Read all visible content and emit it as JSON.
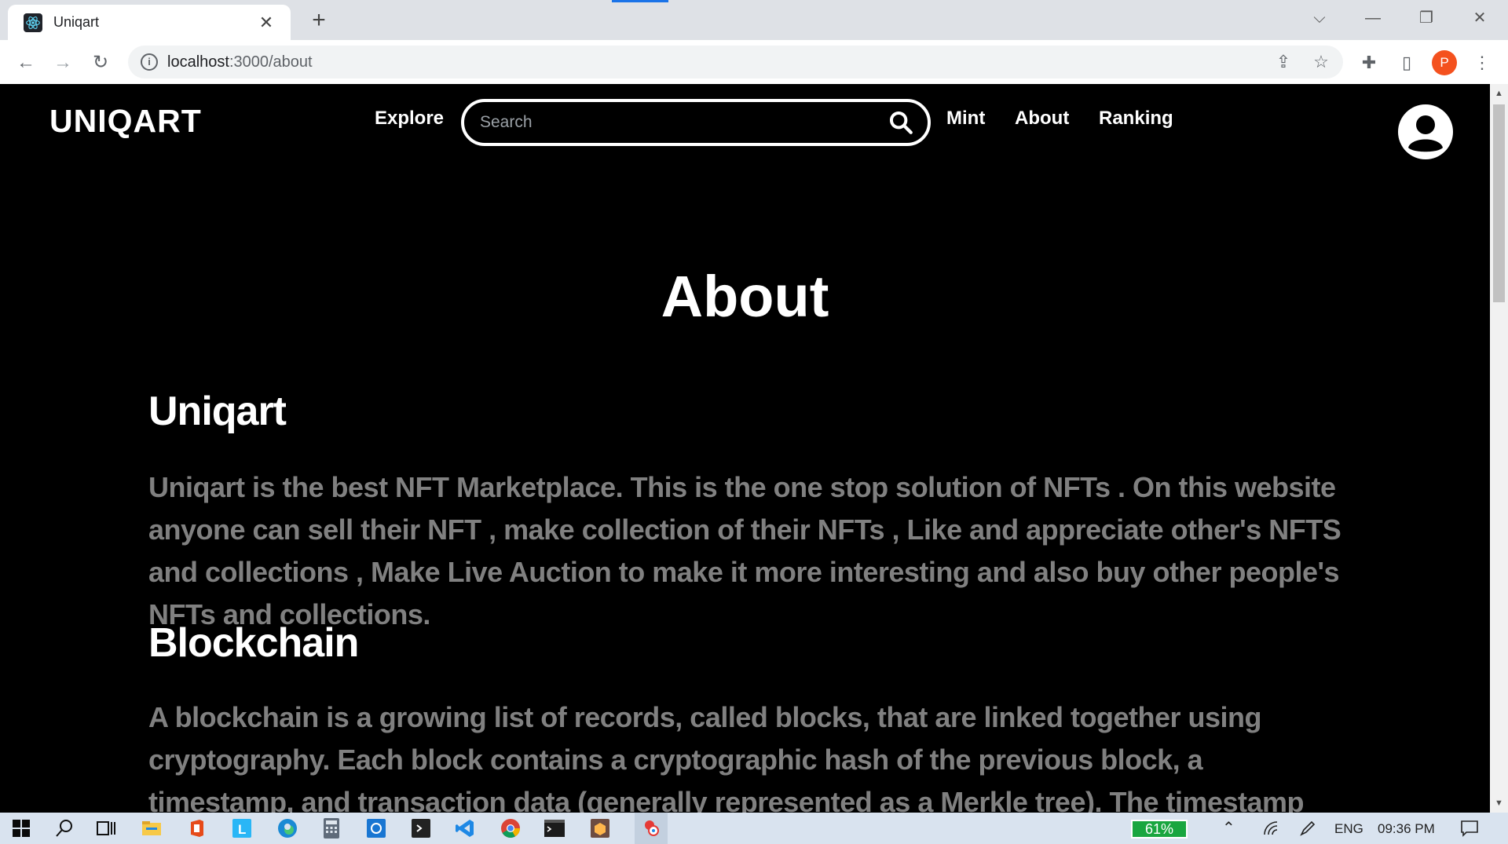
{
  "browser": {
    "tab_title": "Uniqart",
    "url_host": "localhost",
    "url_path": ":3000/about",
    "profile_initial": "P"
  },
  "site": {
    "logo": "UNIQART",
    "nav": {
      "explore": "Explore",
      "mint": "Mint",
      "about": "About",
      "ranking": "Ranking"
    },
    "search_placeholder": "Search"
  },
  "page": {
    "title": "About",
    "sections": [
      {
        "heading": "Uniqart",
        "body": "Uniqart is the best NFT Marketplace. This is the one stop solution of NFTs . On this website anyone can sell their NFT , make collection of their NFTs , Like and appreciate other's NFTS and collections , Make Live Auction to make it more interesting and also buy other people's NFTs and collections."
      },
      {
        "heading": "Blockchain",
        "body": "A blockchain is a growing list of records, called blocks, that are linked together using cryptography. Each block contains a cryptographic hash of the previous block, a timestamp, and transaction data (generally represented as a Merkle tree). The timestamp proves that the transaction data existed when"
      }
    ]
  },
  "taskbar": {
    "battery": "61%",
    "language": "ENG",
    "time": "09:36 PM"
  },
  "colors": {
    "page_bg": "#000000",
    "body_text": "#808080",
    "accent_tab": "#1a73e8",
    "profile": "#f4511e",
    "battery": "#19a63f"
  }
}
